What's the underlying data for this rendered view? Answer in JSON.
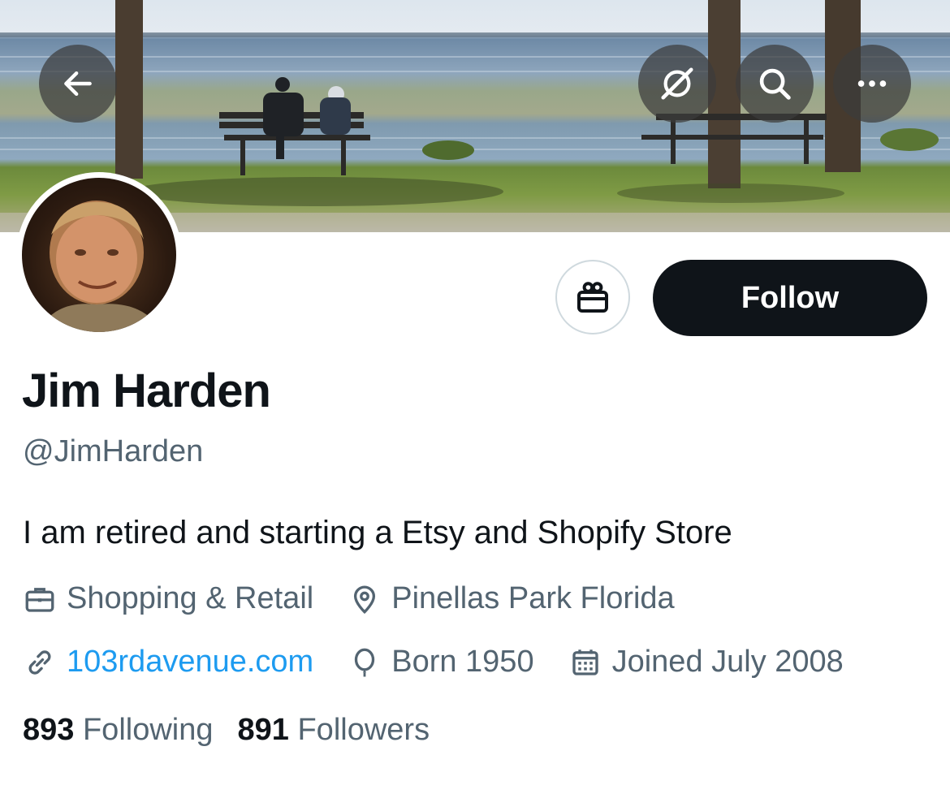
{
  "profile": {
    "display_name": "Jim Harden",
    "handle": "@JimHarden",
    "bio": "I am retired and starting a Etsy and Shopify Store",
    "category": "Shopping & Retail",
    "location": "Pinellas Park Florida",
    "website": "103rdavenue.com",
    "born": "Born 1950",
    "joined": "Joined July 2008",
    "following_count": "893",
    "following_label": "Following",
    "followers_count": "891",
    "followers_label": "Followers"
  },
  "actions": {
    "follow_label": "Follow"
  },
  "icons": {
    "back": "arrow-left-icon",
    "grok": "grok-slash-icon",
    "search": "search-icon",
    "more": "more-dots-icon",
    "gift": "gift-icon",
    "category": "briefcase-icon",
    "location": "location-pin-icon",
    "website": "link-icon",
    "born": "balloon-icon",
    "joined": "calendar-icon"
  },
  "colors": {
    "text_primary": "#0f1419",
    "text_secondary": "#536471",
    "link": "#1d9bf0",
    "follow_bg": "#0f1419"
  }
}
